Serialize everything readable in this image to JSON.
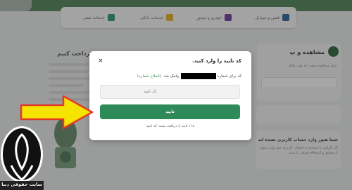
{
  "background": {
    "categories": [
      {
        "label": "قبض و موبایل",
        "color": "#3e6e9e"
      },
      {
        "label": "خودرو و موتور",
        "color": "#7a4aa0"
      },
      {
        "label": "خدمات بانکی",
        "color": "#e0b23a"
      },
      {
        "label": "خدمات سفر",
        "color": "#3e9e7a"
      }
    ],
    "right_card_title": "مشاهده و پ",
    "right_card_text": "برای مشاهده نتیجه، کد ملی مالک",
    "left_card_title": "؟ برداخت کنیم",
    "right_card2_title": "شما هنوز وارد حساب کاربری نشده اید",
    "right_card2_text": "اگر الزامی با شماره به حساب کاربری خود وارد شوید تا سوابق و استعلام قبوض را ببینید"
  },
  "modal": {
    "title": "کد تایید را وارد کنید.",
    "close_icon": "×",
    "desc_prefix": "کد برای شماره",
    "desc_suffix": "پیامک شد.",
    "edit_link": "(اصلاح شماره)",
    "input_placeholder": "کد تایید",
    "confirm_label": "تایید",
    "resend_text": "۱۱۸ ثانیه تا دریافت مجدد کد تایید"
  },
  "logo": {
    "text": "سایت حقوقی دینا"
  },
  "colors": {
    "accent": "#2f8a59",
    "arrow": "#f5e400",
    "arrow_outline": "#e23a2a"
  }
}
